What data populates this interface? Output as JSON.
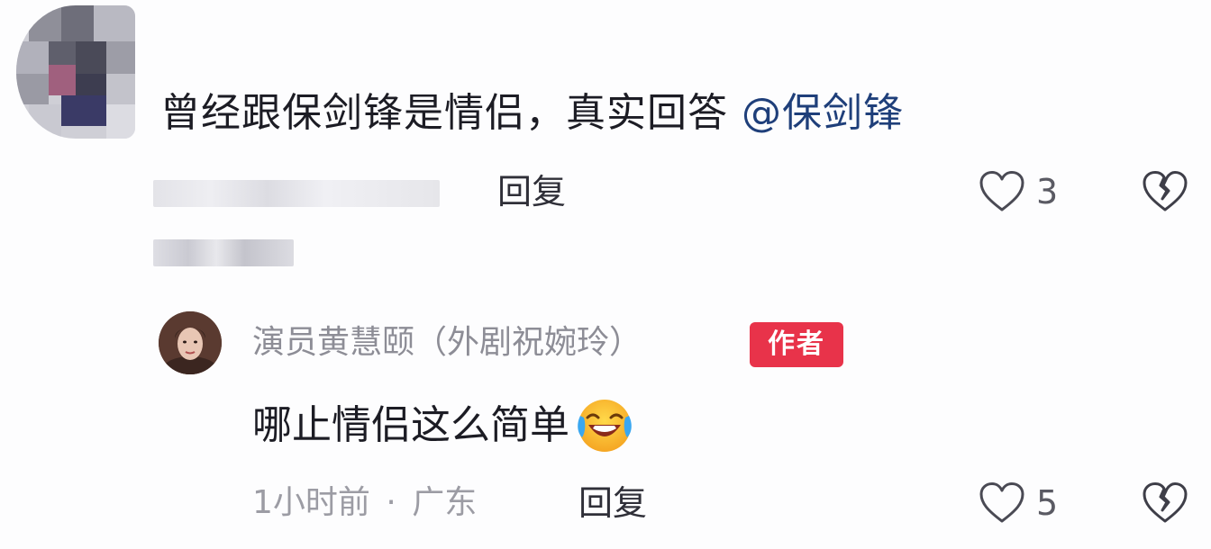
{
  "top_comment": {
    "text": "曾经跟保剑锋是情侣，真实回答",
    "mention": "@保剑锋",
    "reply_label": "回复",
    "like_count": "3",
    "like_icon": "heart-outline-icon",
    "dislike_icon": "broken-heart-icon"
  },
  "author_reply": {
    "name": "演员黄慧颐（外剧祝婉玲）",
    "badge": "作者",
    "text": "哪止情侣这么简单",
    "emoji": "laughing-crying-emoji",
    "time": "1小时前",
    "separator": "·",
    "location": "广东",
    "reply_label": "回复",
    "like_count": "5",
    "like_icon": "heart-outline-icon",
    "dislike_icon": "broken-heart-icon"
  },
  "colors": {
    "badge": "#e8334a",
    "mention": "#1f3f7a",
    "text": "#1c1c24",
    "secondary": "#9c9ca4"
  }
}
